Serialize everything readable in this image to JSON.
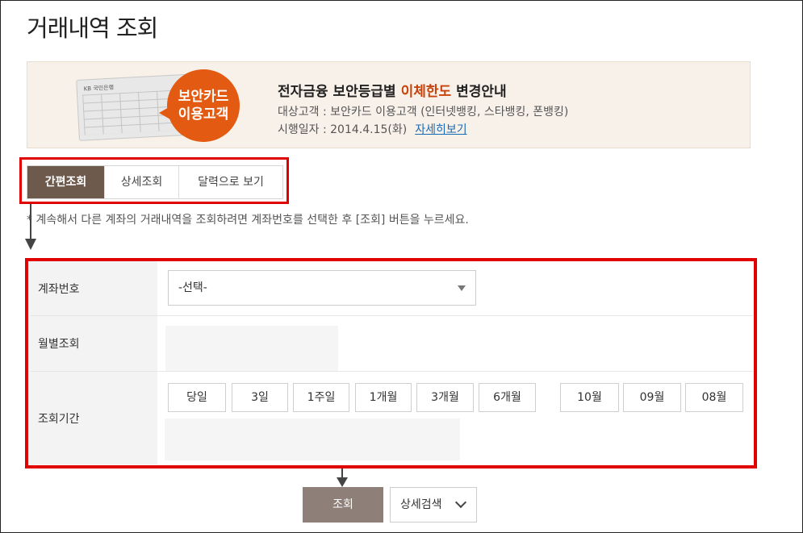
{
  "page": {
    "title": "거래내역 조회"
  },
  "banner": {
    "card_brand": "KB 국민은행",
    "badge_line1": "보안카드",
    "badge_line2": "이용고객",
    "title_prefix": "전자금융 보안등급별 ",
    "title_highlight": "이체한도",
    "title_suffix": " 변경안내",
    "target_line": "대상고객 : 보안카드 이용고객 (인터넷뱅킹, 스타뱅킹, 폰뱅킹)",
    "date_line": "시행일자 : 2014.4.15(화)",
    "link_label": "자세히보기"
  },
  "tabs": [
    {
      "label": "간편조회",
      "active": true
    },
    {
      "label": "상세조회",
      "active": false
    },
    {
      "label": "달력으로 보기",
      "active": false
    }
  ],
  "info_text": "* 계속해서 다른 계좌의 거래내역을 조회하려면 계좌번호를 선택한 후 [조회] 버튼을 누르세요.",
  "form": {
    "account_label": "계좌번호",
    "account_select_value": "-선택-",
    "monthly_label": "월별조회",
    "period_label": "조회기간",
    "period_buttons": [
      "당일",
      "3일",
      "1주일",
      "1개월",
      "3개월",
      "6개월"
    ],
    "month_buttons": [
      "10월",
      "09월",
      "08월"
    ]
  },
  "actions": {
    "search_label": "조회",
    "detail_search_label": "상세검색"
  },
  "colors": {
    "active_tab": "#6d5a4c",
    "highlight_red": "#e00000",
    "banner_accent": "#e35b12",
    "search_button": "#8e8078"
  }
}
